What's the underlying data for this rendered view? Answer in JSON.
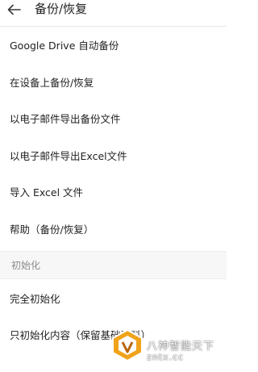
{
  "header": {
    "back_icon": "arrow-left-icon",
    "title": "备份/恢复"
  },
  "menu": [
    {
      "label": "Google Drive 自动备份"
    },
    {
      "label": "在设备上备份/恢复"
    },
    {
      "label": "以电子邮件导出备份文件"
    },
    {
      "label": "以电子邮件导出Excel文件"
    },
    {
      "label": "导入 Excel 文件"
    },
    {
      "label": "帮助（备份/恢复）"
    }
  ],
  "section": {
    "title": "初始化"
  },
  "reset_menu": [
    {
      "label": "完全初始化"
    },
    {
      "label": "只初始化内容（保留基础资料）"
    }
  ],
  "watermark": {
    "brand": "八神智能天下",
    "site": "zntx.cc",
    "colors": {
      "logo_orange": "#f0a31a",
      "logo_dark": "#b9650f"
    }
  }
}
